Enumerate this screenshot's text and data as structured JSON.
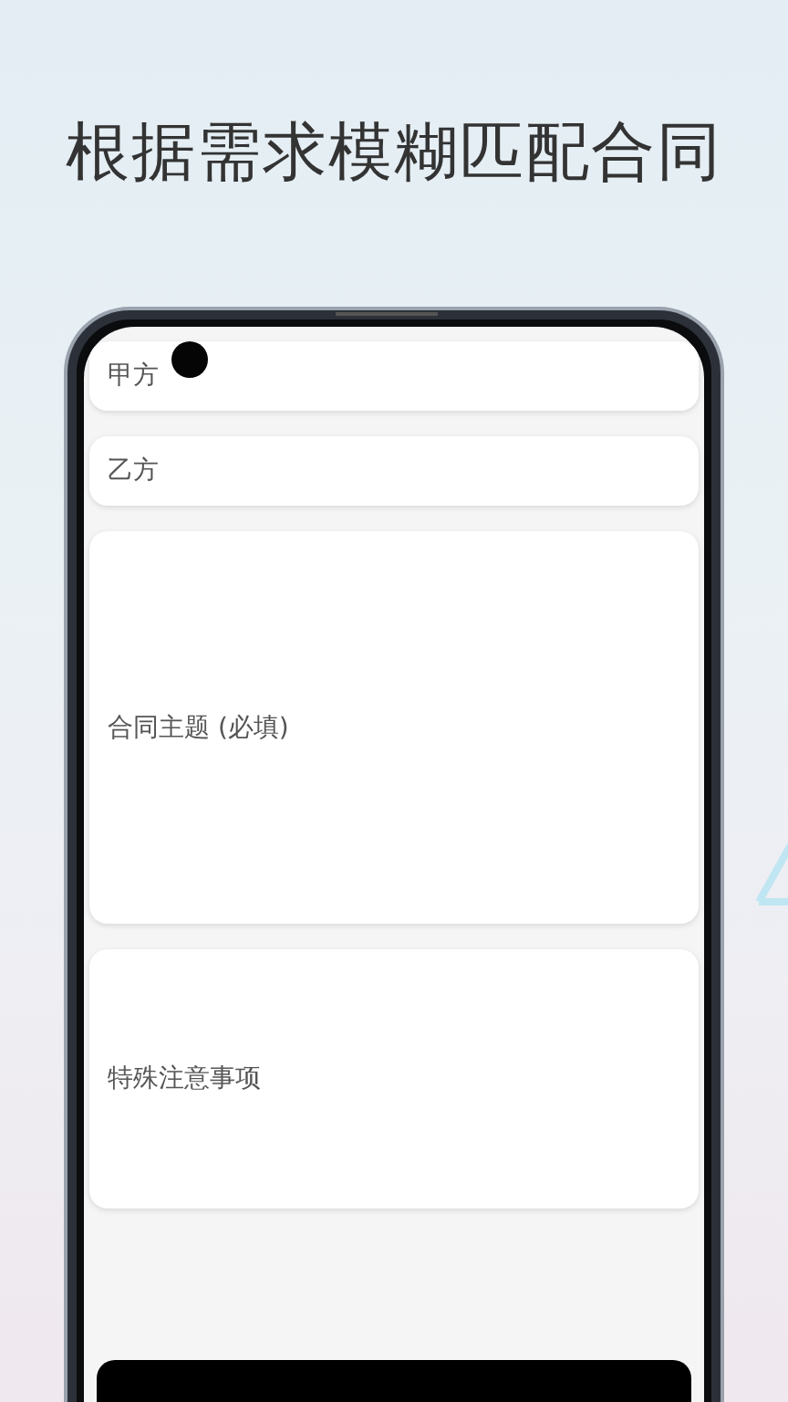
{
  "headline": "根据需求模糊匹配合同",
  "fields": [
    {
      "kind": "line",
      "placeholder": "甲方"
    },
    {
      "kind": "line",
      "placeholder": "乙方"
    },
    {
      "kind": "area-large",
      "placeholder": "合同主题 (必填)"
    },
    {
      "kind": "area-medium",
      "placeholder": "特殊注意事项"
    }
  ],
  "action_button": {
    "kind": "primary"
  }
}
